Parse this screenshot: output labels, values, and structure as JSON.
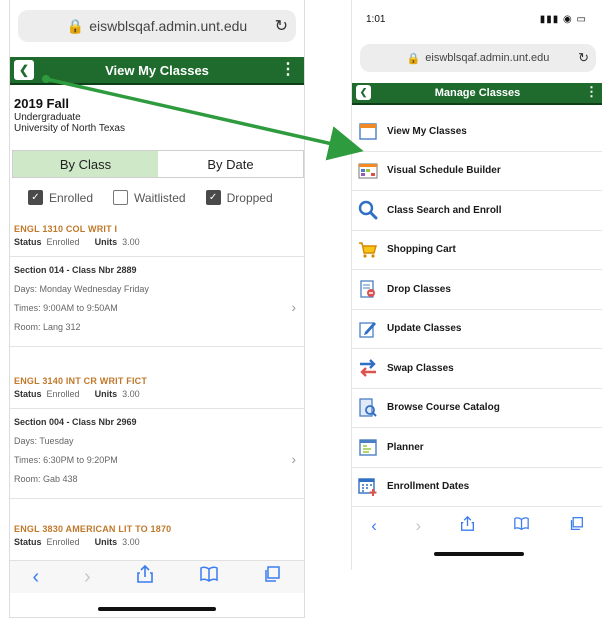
{
  "left_phone": {
    "url": "eiswblsqaf.admin.unt.edu",
    "header_title": "View My Classes",
    "term": "2019 Fall",
    "career": "Undergraduate",
    "institution": "University of North Texas",
    "tabs": [
      {
        "label": "By Class",
        "active": true
      },
      {
        "label": "By Date",
        "active": false
      }
    ],
    "filters": [
      {
        "label": "Enrolled",
        "checked": true
      },
      {
        "label": "Waitlisted",
        "checked": false
      },
      {
        "label": "Dropped",
        "checked": true
      }
    ],
    "status_label": "Status",
    "units_label": "Units",
    "courses": [
      {
        "title": "ENGL 1310   COL WRIT I",
        "status": "Enrolled",
        "units": "3.00",
        "section": "Section 014 - Class Nbr 2889",
        "days": "Days: Monday Wednesday Friday",
        "times": "Times: 9:00AM to 9:50AM",
        "room": "Room: Lang  312"
      },
      {
        "title": "ENGL 3140   INT CR WRIT FICT",
        "status": "Enrolled",
        "units": "3.00",
        "section": "Section 004 - Class Nbr 2969",
        "days": "Days: Tuesday",
        "times": "Times: 6:30PM to 9:20PM",
        "room": "Room: Gab  438"
      },
      {
        "title": "ENGL 3830   AMERICAN LIT TO 1870",
        "status": "Enrolled",
        "units": "3.00"
      }
    ]
  },
  "right_phone": {
    "time": "1:01",
    "url": "eiswblsqaf.admin.unt.edu",
    "header_title": "Manage Classes",
    "menu": [
      {
        "label": "View My Classes",
        "icon": "calendar-icon"
      },
      {
        "label": "Visual Schedule Builder",
        "icon": "schedule-grid-icon"
      },
      {
        "label": "Class Search and Enroll",
        "icon": "search-icon"
      },
      {
        "label": "Shopping Cart",
        "icon": "cart-icon"
      },
      {
        "label": "Drop Classes",
        "icon": "drop-icon"
      },
      {
        "label": "Update Classes",
        "icon": "edit-icon"
      },
      {
        "label": "Swap Classes",
        "icon": "swap-icon"
      },
      {
        "label": "Browse Course Catalog",
        "icon": "catalog-icon"
      },
      {
        "label": "Planner",
        "icon": "planner-icon"
      },
      {
        "label": "Enrollment Dates",
        "icon": "enrollment-dates-icon"
      }
    ]
  },
  "colors": {
    "header_green": "#1f6b2d",
    "tab_active": "#cfe8c8",
    "course_title": "#c0782a",
    "arrow": "#2e9b3e",
    "ios_blue": "#3b7cf0"
  }
}
